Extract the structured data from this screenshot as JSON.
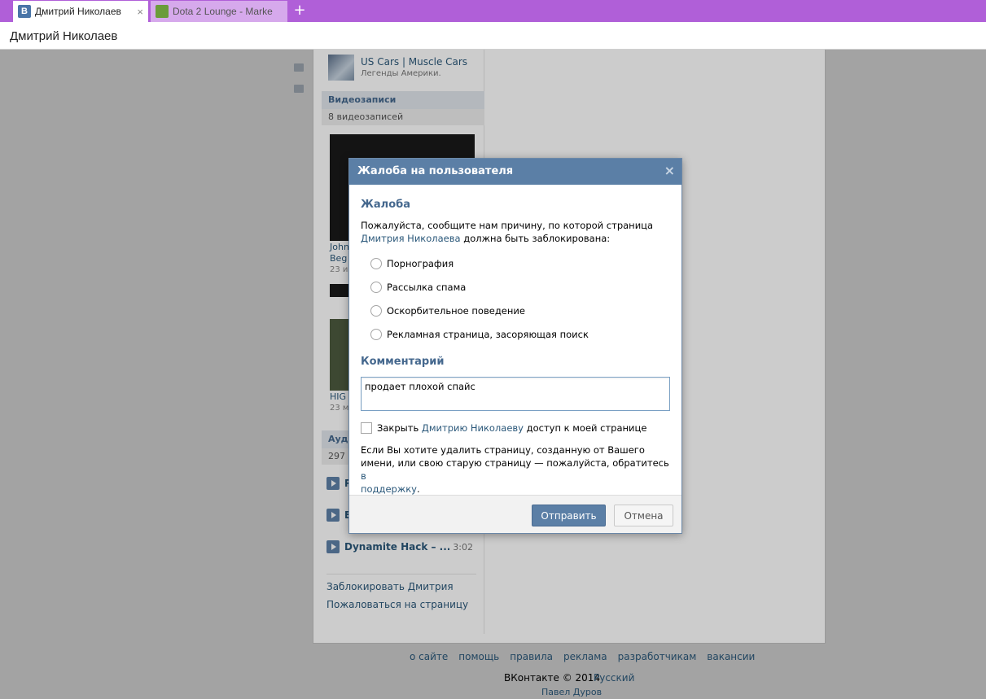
{
  "browser": {
    "tabs": [
      {
        "title": "Дмитрий Николаев",
        "favicon": "vk-icon",
        "close": "×"
      },
      {
        "title": "Dota 2 Lounge - Marke",
        "favicon": "dota-icon"
      }
    ],
    "new_tab": "+",
    "address_text": "Дмитрий Николаев"
  },
  "sidebar": {
    "group": {
      "name": "US Cars | Muscle Cars",
      "subtitle": "Легенды Америки."
    },
    "videos": {
      "title": "Видеозаписи",
      "count": "8 видеозаписей",
      "items": [
        {
          "caption_1": "John",
          "caption_2": "Beg",
          "date": "23 и"
        },
        {
          "caption_1": "HIG",
          "date": "23 м"
        }
      ]
    },
    "audio": {
      "title": "Ауди",
      "count": "297",
      "items": [
        {
          "title": "P",
          "duration": ""
        },
        {
          "title": "E",
          "duration": ""
        },
        {
          "title": "Dynamite Hack – ...",
          "duration": "3:02"
        }
      ]
    },
    "actions": {
      "block": "Заблокировать Дмитрия",
      "report": "Пожаловаться на страницу"
    }
  },
  "footer": {
    "links": [
      "о сайте",
      "помощь",
      "правила",
      "реклама",
      "разработчикам",
      "вакансии"
    ],
    "copyright": "ВКонтакте © 2014",
    "language": "Русский",
    "author": "Павел Дуров"
  },
  "modal": {
    "title": "Жалоба на пользователя",
    "close": "×",
    "complaint_heading": "Жалоба",
    "desc_prefix": "Пожалуйста, сообщите нам причину, по которой страница",
    "desc_link": "Дмитрия Николаева",
    "desc_suffix": "должна быть заблокирована:",
    "reasons": [
      "Порнография",
      "Рассылка спама",
      "Оскорбительное поведение",
      "Рекламная страница, засоряющая поиск"
    ],
    "comment_heading": "Комментарий",
    "comment_value": "продает плохой спайс",
    "checkbox_prefix": "Закрыть",
    "checkbox_link": "Дмитрию Николаеву",
    "checkbox_suffix": "доступ к моей странице",
    "note_text": "Если Вы хотите удалить страницу, созданную от Вашего имени, или свою старую страницу — пожалуйста, обратитесь",
    "note_link_1": "в",
    "note_link_2": "поддержку",
    "note_end": ".",
    "submit_label": "Отправить",
    "cancel_label": "Отмена"
  },
  "colors": {
    "tabbar": "#b05fd8",
    "modal_header": "#5b7fa6",
    "link": "#2b587a"
  }
}
